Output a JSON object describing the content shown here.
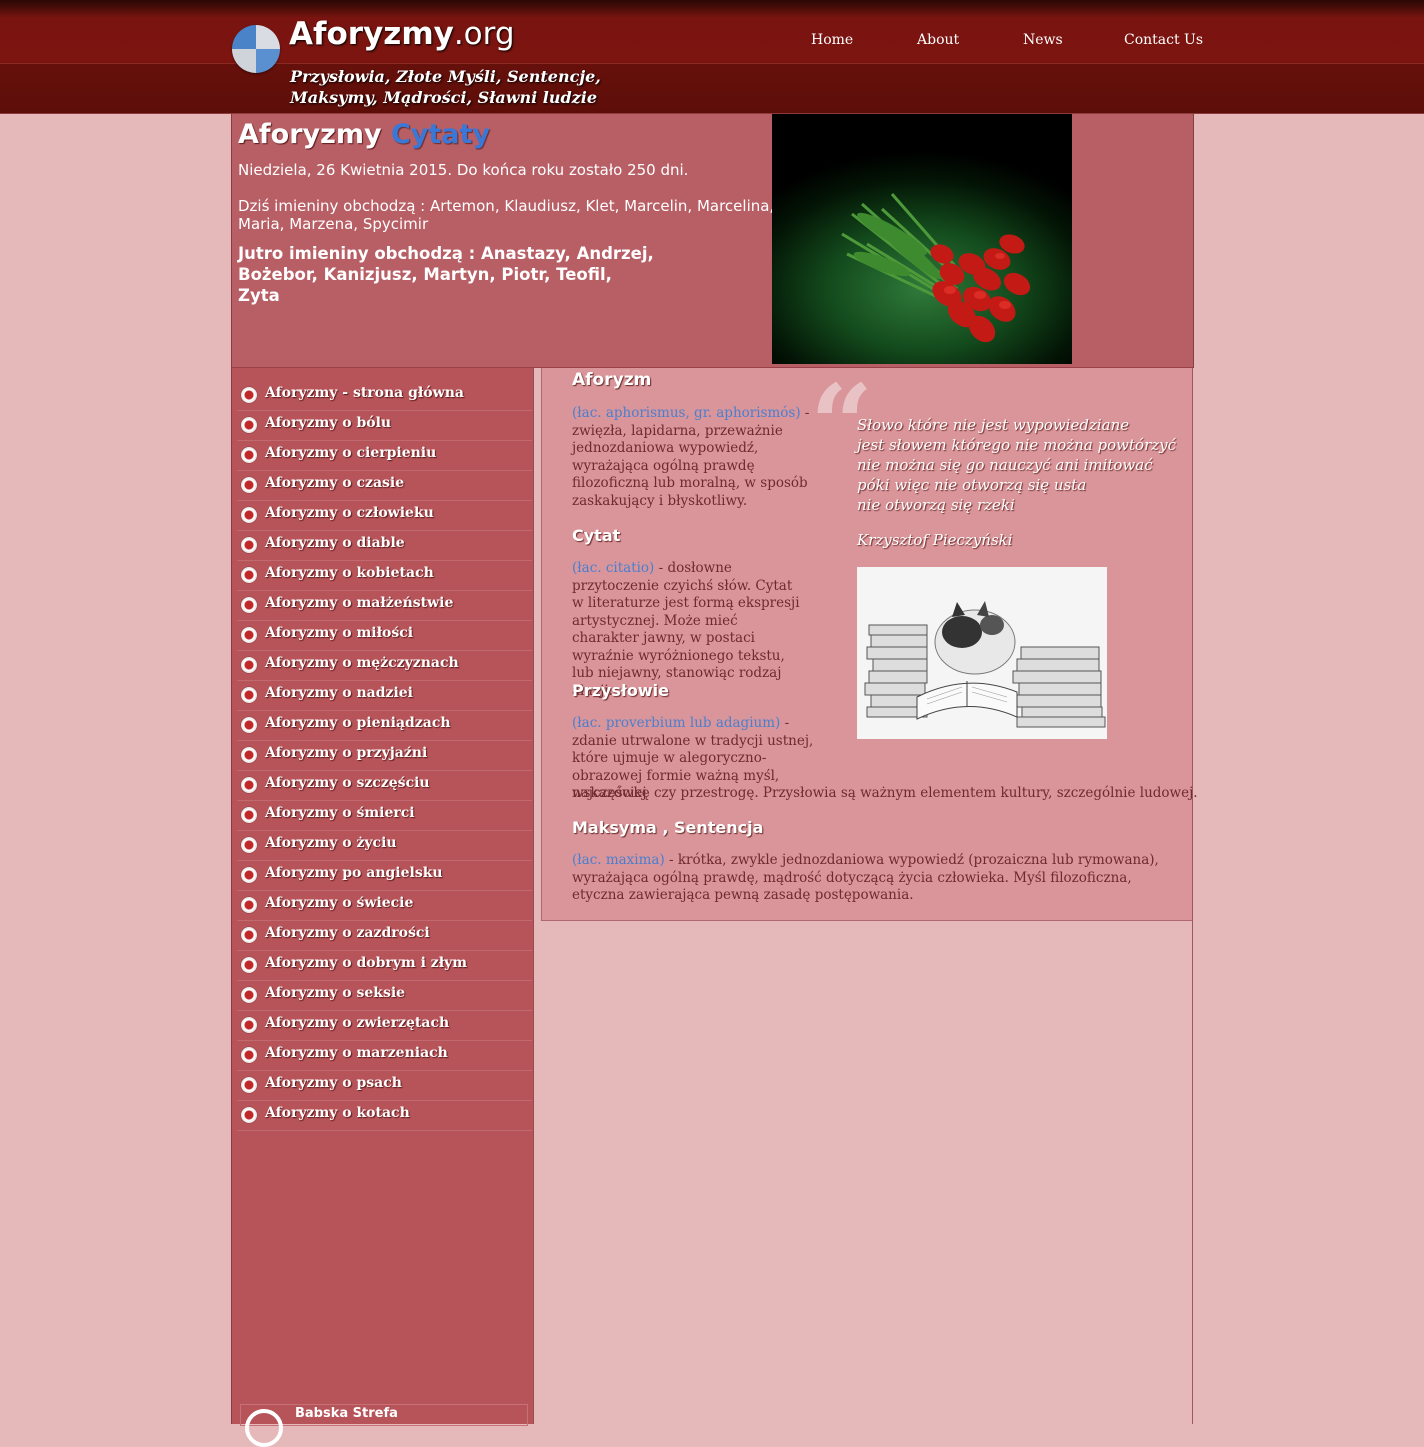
{
  "header": {
    "logo_main": "Aforyzmy",
    "logo_tld": ".org",
    "tagline_line1": "Przysłowia, Złote Myśli, Sentencje,",
    "tagline_line2": "Maksymy, Mądrości, Sławni ludzie"
  },
  "nav": [
    {
      "label": "Home"
    },
    {
      "label": "About"
    },
    {
      "label": "News"
    },
    {
      "label": "Contact Us"
    }
  ],
  "top": {
    "title_main": "Aforyzmy",
    "title_accent": "Cytaty",
    "date_line": "Niedziela, 26 Kwietnia 2015. Do końca roku zostało 250 dni.",
    "names_today": "Dziś imieniny obchodzą : Artemon, Klaudiusz, Klet, Marcelin, Marcelina, Maria, Marzena, Spycimir",
    "names_tomorrow": "Jutro imieniny obchodzą : Anastazy, Andrzej, Bożebor, Kanizjusz, Martyn, Piotr, Teofil, Zyta"
  },
  "sidebar": {
    "items": [
      {
        "label": "Aforyzmy - strona główna"
      },
      {
        "label": "Aforyzmy o bólu"
      },
      {
        "label": "Aforyzmy o cierpieniu"
      },
      {
        "label": "Aforyzmy o czasie"
      },
      {
        "label": "Aforyzmy o człowieku"
      },
      {
        "label": "Aforyzmy o diable"
      },
      {
        "label": "Aforyzmy o kobietach"
      },
      {
        "label": "Aforyzmy o małżeństwie"
      },
      {
        "label": "Aforyzmy o miłości"
      },
      {
        "label": "Aforyzmy o mężczyznach"
      },
      {
        "label": "Aforyzmy o nadziei"
      },
      {
        "label": "Aforyzmy o pieniądzach"
      },
      {
        "label": "Aforyzmy o przyjaźni"
      },
      {
        "label": "Aforyzmy o szczęściu"
      },
      {
        "label": "Aforyzmy o śmierci"
      },
      {
        "label": "Aforyzmy o życiu"
      },
      {
        "label": "Aforyzmy po angielsku"
      },
      {
        "label": "Aforyzmy o świecie"
      },
      {
        "label": "Aforyzmy o zazdrości"
      },
      {
        "label": "Aforyzmy o dobrym i złym"
      },
      {
        "label": "Aforyzmy o seksie"
      },
      {
        "label": "Aforyzmy o zwierzętach"
      },
      {
        "label": "Aforyzmy o marzeniach"
      },
      {
        "label": "Aforyzmy o psach"
      },
      {
        "label": "Aforyzmy o kotach"
      }
    ],
    "footer_label": "Babska Strefa"
  },
  "content": {
    "aforyzm": {
      "heading": "Aforyzm",
      "latin": "(łac. aphorismus, gr. aphorismós)",
      "text": " - zwięzła, lapidarna, przeważnie jednozdaniowa wypowiedź, wyrażająca ogólną prawdę filozoficzną lub moralną, w sposób zaskakujący i błyskotliwy."
    },
    "cytat": {
      "heading": "Cytat",
      "latin": "(łac. citatio)",
      "text": " - dosłowne przytoczenie czyichś słów. Cytat w literaturze jest formą ekspresji artystycznej. Może mieć charakter jawny, w postaci wyraźnie wyróżnionego tekstu, lub niejawny, stanowiąc rodzaj aluzji."
    },
    "przyslowie": {
      "heading": "Przysłowie",
      "latin": "(łac. proverbium lub adagium)",
      "text_part1": " - zdanie utrwalone w tradycji ustnej, które ujmuje w alegoryczno-obrazowej formie ważną myśl, najczęściej",
      "text_part2": "wskazówkę czy przestrogę. Przysłowia są ważnym elementem kultury, szczególnie ludowej."
    },
    "maksyma": {
      "heading": "Maksyma , Sentencja",
      "latin": "(łac. maxima)",
      "text": " - krótka, zwykle jednozdaniowa wypowiedź (prozaiczna lub rymowana), wyrażająca ogólną prawdę, mądrość dotyczącą życia człowieka. Myśl filozoficzna, etyczna zawierająca pewną zasadę postępowania."
    },
    "quote": {
      "lines": [
        "Słowo które nie jest wypowiedziane",
        "jest słowem którego nie można powtórzyć",
        "nie można się go nauczyć ani imitować",
        "póki więc nie otworzą się usta",
        "nie otworzą się rzeki"
      ],
      "author": "Krzysztof Pieczyński"
    }
  }
}
